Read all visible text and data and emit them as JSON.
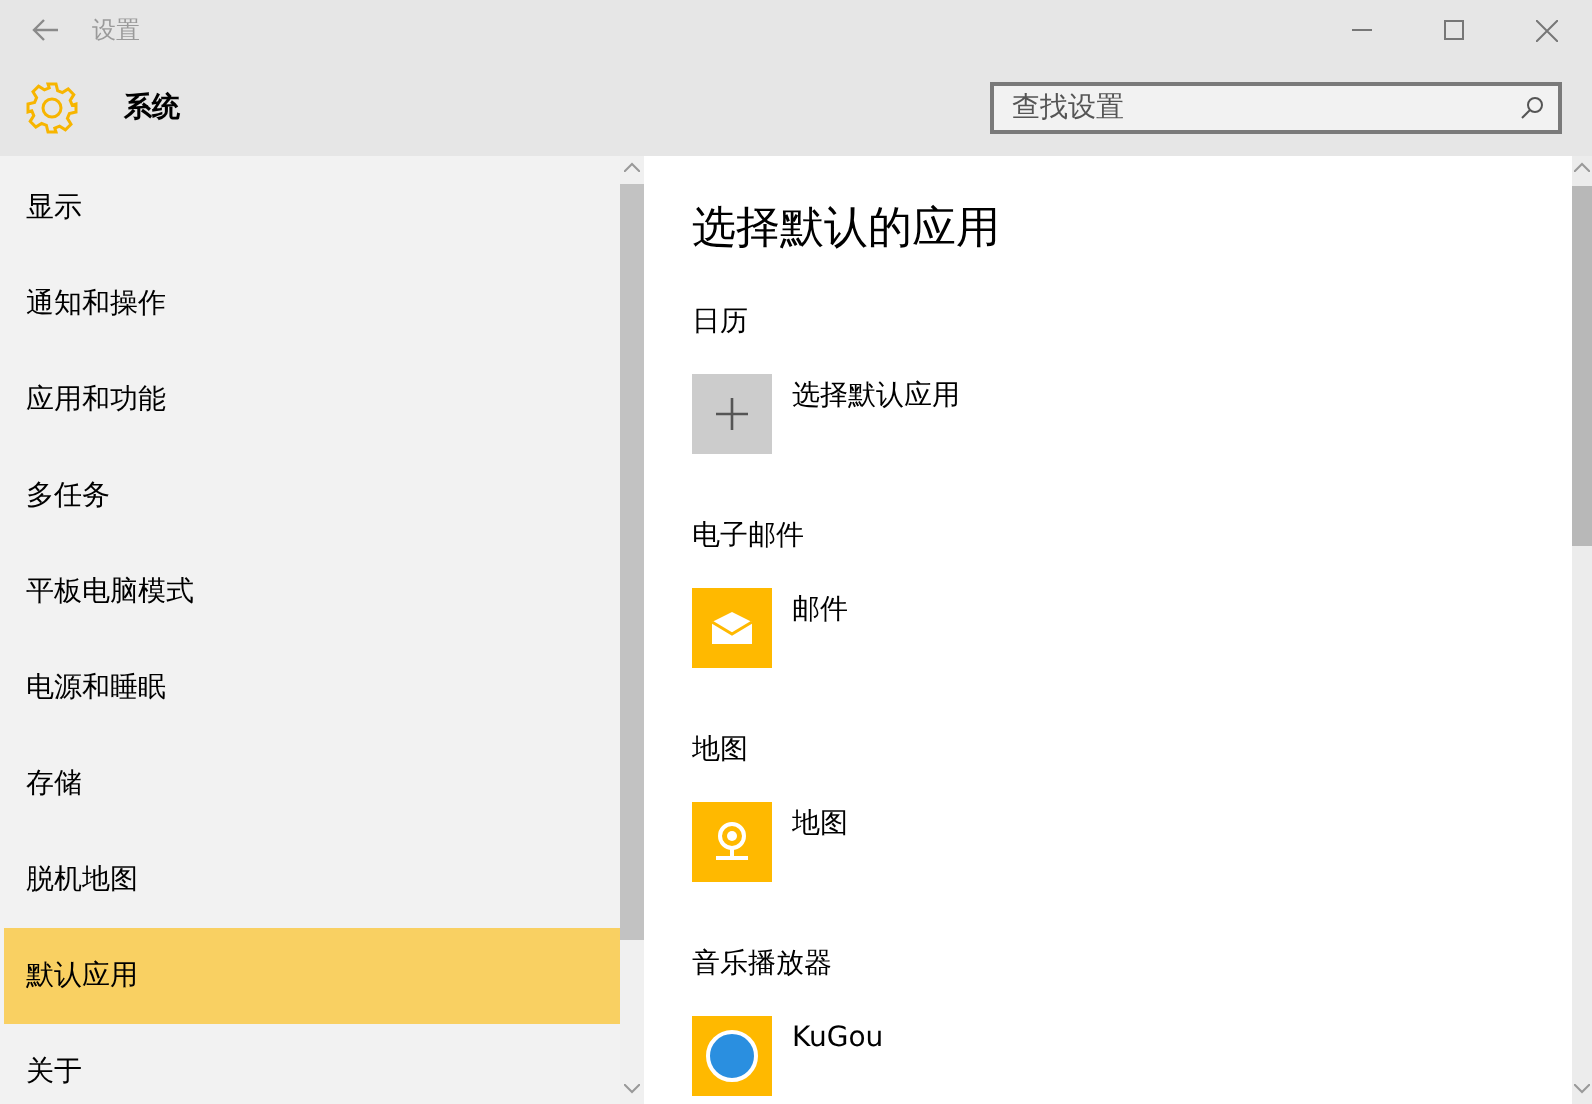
{
  "window": {
    "title": "设置"
  },
  "header": {
    "title": "系统",
    "search": {
      "placeholder": "查找设置"
    }
  },
  "sidebar": {
    "items": [
      {
        "label": "显示",
        "selected": false
      },
      {
        "label": "通知和操作",
        "selected": false
      },
      {
        "label": "应用和功能",
        "selected": false
      },
      {
        "label": "多任务",
        "selected": false
      },
      {
        "label": "平板电脑模式",
        "selected": false
      },
      {
        "label": "电源和睡眠",
        "selected": false
      },
      {
        "label": "存储",
        "selected": false
      },
      {
        "label": "脱机地图",
        "selected": false
      },
      {
        "label": "默认应用",
        "selected": true
      },
      {
        "label": "关于",
        "selected": false
      }
    ]
  },
  "content": {
    "title": "选择默认的应用",
    "sections": [
      {
        "heading": "日历",
        "app": {
          "name": "选择默认应用",
          "kind": "add"
        }
      },
      {
        "heading": "电子邮件",
        "app": {
          "name": "邮件",
          "kind": "mail"
        }
      },
      {
        "heading": "地图",
        "app": {
          "name": "地图",
          "kind": "map"
        }
      },
      {
        "heading": "音乐播放器",
        "app": {
          "name": "KuGou",
          "kind": "music"
        }
      }
    ]
  }
}
